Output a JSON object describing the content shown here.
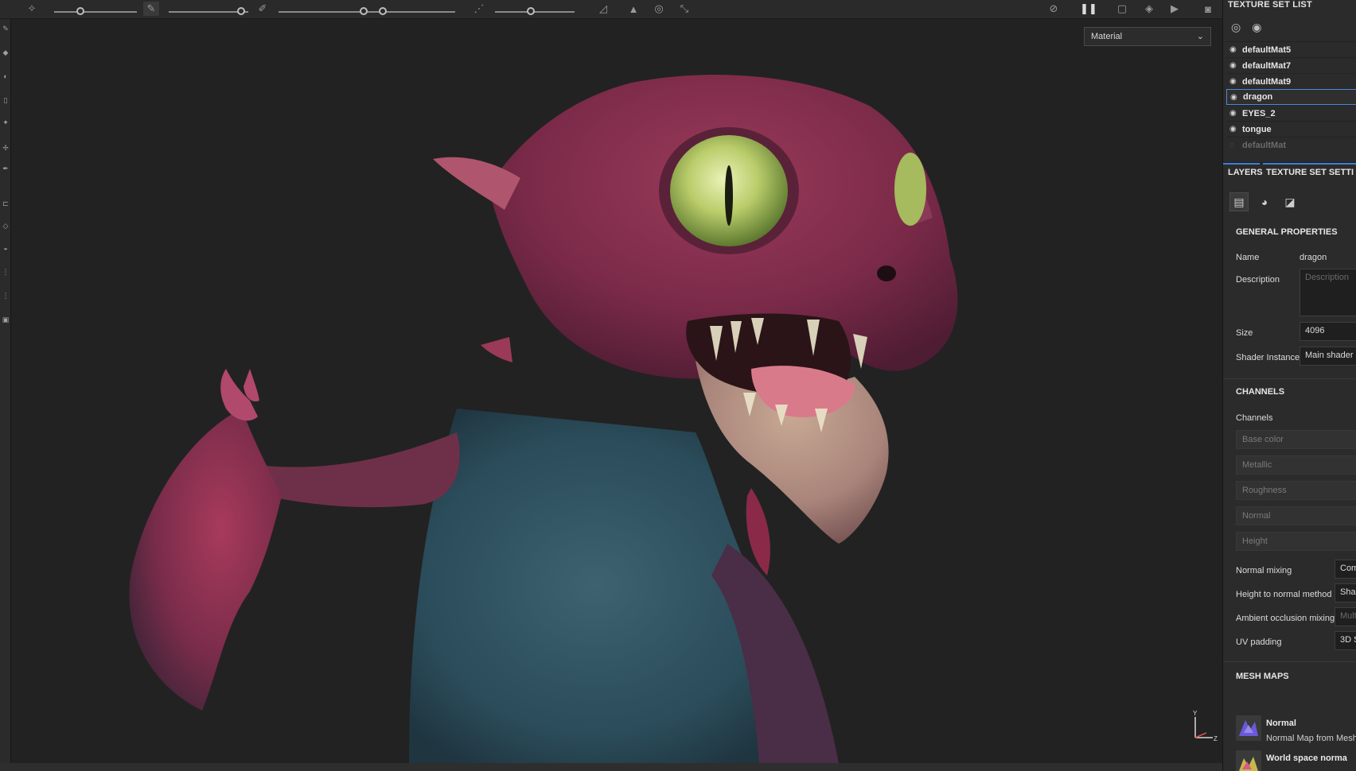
{
  "toolbar": {
    "icons": [
      "brush-settings-icon",
      "pen-icon",
      "brush-icon",
      "symmetry-icon",
      "mirror-icon",
      "lazy-mouse-icon",
      "pause-icon",
      "camera-icon"
    ]
  },
  "viewport": {
    "display_mode": "Material",
    "axis": {
      "y_label": "Y",
      "z_label": "Z"
    }
  },
  "texture_set_list": {
    "title": "TEXTURE SET LIST",
    "items": [
      {
        "name": "defaultMat5",
        "visible": true
      },
      {
        "name": "defaultMat7",
        "visible": true
      },
      {
        "name": "defaultMat9",
        "visible": true
      },
      {
        "name": "dragon",
        "visible": true,
        "selected": true
      },
      {
        "name": "EYES_2",
        "visible": true
      },
      {
        "name": "tongue",
        "visible": true
      },
      {
        "name": "defaultMat",
        "visible": false
      }
    ]
  },
  "tabs": {
    "layers": "LAYERS",
    "texture_set_settings": "TEXTURE SET SETTI"
  },
  "general": {
    "heading": "GENERAL PROPERTIES",
    "name_label": "Name",
    "name_value": "dragon",
    "description_label": "Description",
    "description_placeholder": "Description",
    "size_label": "Size",
    "size_value": "4096",
    "shader_label": "Shader Instance",
    "shader_value": "Main shader"
  },
  "channels": {
    "heading": "CHANNELS",
    "label": "Channels",
    "items": [
      "Base color",
      "Metallic",
      "Roughness",
      "Normal",
      "Height"
    ],
    "normal_mixing_label": "Normal mixing",
    "normal_mixing_value": "Com",
    "height_to_normal_label": "Height to normal method",
    "height_to_normal_value": "Shar",
    "ao_mixing_label": "Ambient occlusion mixing",
    "ao_mixing_value": "Mult",
    "uv_padding_label": "UV padding",
    "uv_padding_value": "3D S"
  },
  "mesh_maps": {
    "heading": "MESH MAPS",
    "items": [
      {
        "title": "Normal",
        "subtitle": "Normal Map from Mesh"
      },
      {
        "title": "World space norma",
        "subtitle": ""
      }
    ]
  },
  "colors": {
    "accent": "#3d7fd6",
    "panel_bg": "#2b2b2b",
    "viewport_bg": "#222222"
  }
}
